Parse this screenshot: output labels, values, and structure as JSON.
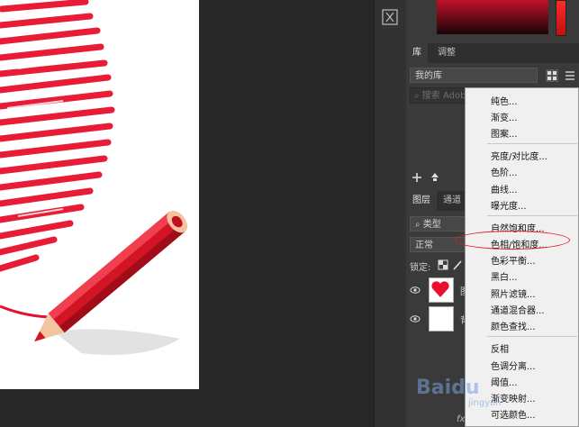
{
  "library_panel": {
    "tabs": [
      "库",
      "调整"
    ],
    "my_library": "我的库",
    "search_placeholder": "搜索 Adobe"
  },
  "layers_panel": {
    "tabs": [
      "图层",
      "通道"
    ],
    "filter_kind": "类型",
    "blend_mode": "正常",
    "lock_label": "锁定:",
    "layer1_name": "图",
    "layer2_name": "背"
  },
  "adjustment_menu": {
    "items_group1": [
      "纯色...",
      "渐变...",
      "图案..."
    ],
    "items_group2": [
      "亮度/对比度...",
      "色阶...",
      "曲线...",
      "曝光度..."
    ],
    "items_group3": [
      "自然饱和度...",
      "色相/饱和度...",
      "色彩平衡...",
      "黑白...",
      "照片滤镜...",
      "通道混合器...",
      "颜色查找..."
    ],
    "items_group4": [
      "反相",
      "色调分离...",
      "阈值...",
      "渐变映射...",
      "可选颜色..."
    ]
  },
  "bottom": {
    "fx": "fx"
  },
  "watermark": {
    "text": "Baidu",
    "sub": "jingyan"
  },
  "colors": {
    "highlight_ellipse": "#e31a2c",
    "heart_red": "#e8102e",
    "menu_bg": "#f0f0f0",
    "panel_bg": "#3a3a3a"
  }
}
